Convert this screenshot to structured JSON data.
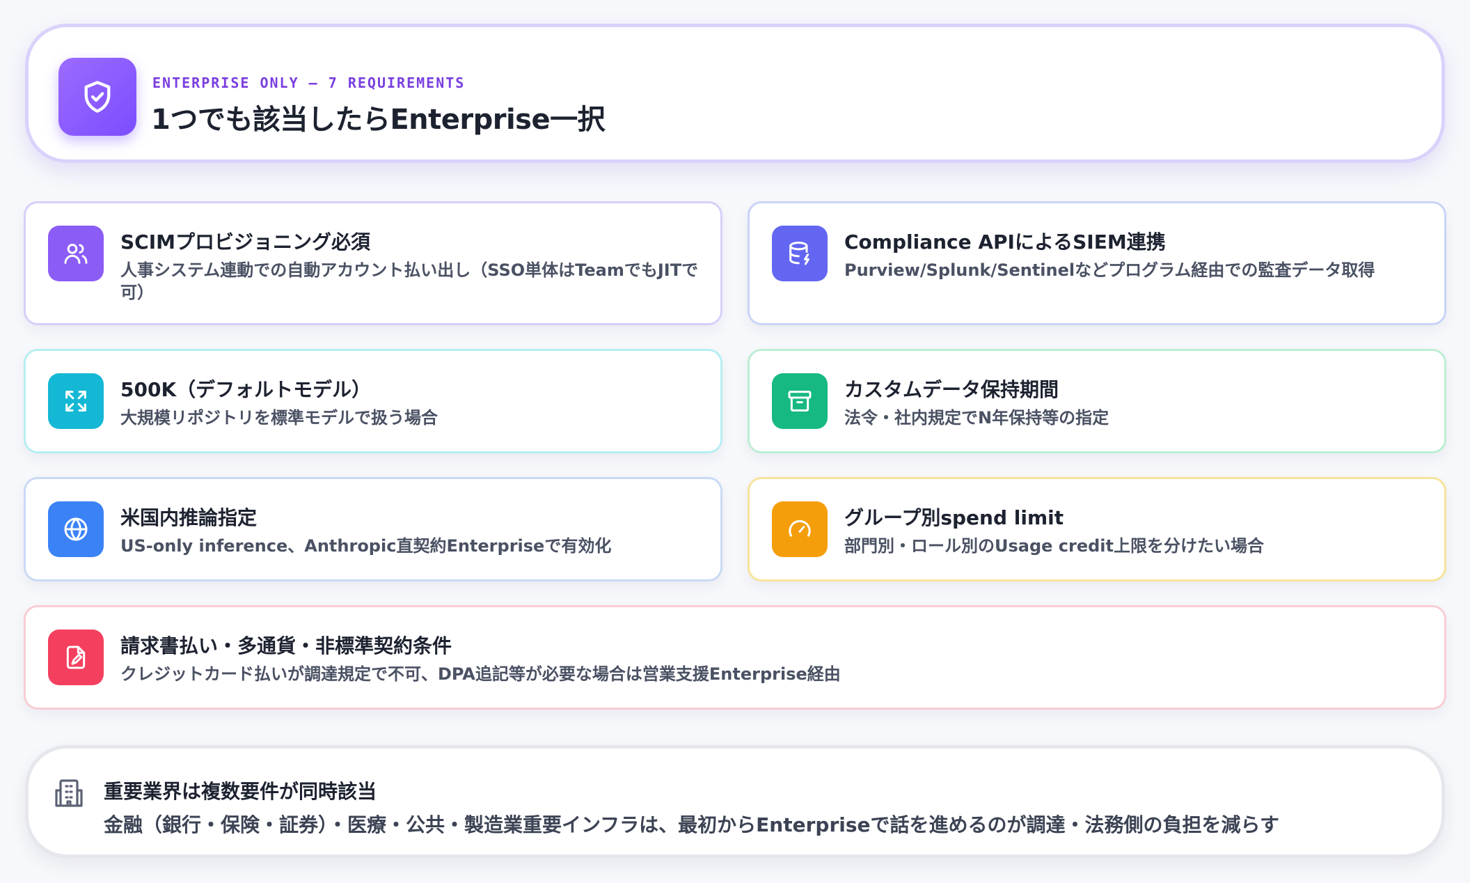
{
  "header": {
    "eyebrow": "ENTERPRISE ONLY — 7 REQUIREMENTS",
    "title": "1つでも該当したらEnterprise一択",
    "icon": "shield-check-icon"
  },
  "requirements": [
    {
      "title": "SCIMプロビジョニング必須",
      "desc": "人事システム連動での自動アカウント払い出し（SSO単体はTeamでもJITで可）",
      "icon": "users-icon",
      "color": "#8b5cf6"
    },
    {
      "title": "Compliance APIによるSIEM連携",
      "desc": "Purview/Splunk/Sentinelなどプログラム経由での監査データ取得",
      "icon": "database-icon",
      "color": "#6366f1"
    },
    {
      "title": "500K（デフォルトモデル）",
      "desc": "大規模リポジトリを標準モデルで扱う場合",
      "icon": "expand-icon",
      "color": "#14b8d4"
    },
    {
      "title": "カスタムデータ保持期間",
      "desc": "法令・社内規定でN年保持等の指定",
      "icon": "archive-icon",
      "color": "#16b981"
    },
    {
      "title": "米国内推論指定",
      "desc": "US-only inference、Anthropic直契約Enterpriseで有効化",
      "icon": "globe-icon",
      "color": "#3b82f6"
    },
    {
      "title": "グループ別spend limit",
      "desc": "部門別・ロール別のUsage credit上限を分けたい場合",
      "icon": "gauge-icon",
      "color": "#f59e0b"
    },
    {
      "title": "請求書払い・多通貨・非標準契約条件",
      "desc": "クレジットカード払いが調達規定で不可、DPA追記等が必要な場合は営業支援Enterprise経由",
      "icon": "file-signature-icon",
      "color": "#f43f5e"
    }
  ],
  "footer": {
    "title": "重要業界は複数要件が同時該当",
    "desc": "金融（銀行・保険・証券）・医療・公共・製造業重要インフラは、最初からEnterpriseで話を進めるのが調達・法務側の負担を減らす",
    "icon": "building-icon"
  }
}
